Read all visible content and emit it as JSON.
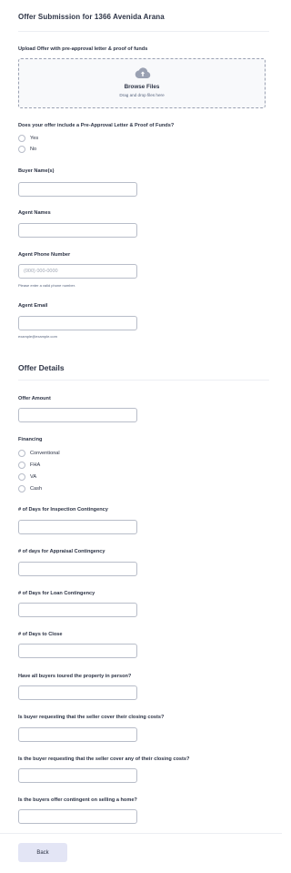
{
  "form": {
    "title": "Offer Submission for 1366 Avenida Arana"
  },
  "upload": {
    "label": "Upload Offer with pre-approval letter & proof of funds",
    "browse_label": "Browse Files",
    "drag_text": "Drag and drop files here",
    "icon": "cloud-upload-icon"
  },
  "preapproval": {
    "label": "Does your offer include a Pre-Approval Letter & Proof of Funds?",
    "options": [
      "Yes",
      "No"
    ]
  },
  "buyer_names": {
    "label": "Buyer Name(s)",
    "value": ""
  },
  "agent_names": {
    "label": "Agent Names",
    "value": ""
  },
  "agent_phone": {
    "label": "Agent Phone Number",
    "placeholder": "(000) 000-0000",
    "sublabel": "Please enter a valid phone number."
  },
  "agent_email": {
    "label": "Agent Email",
    "sublabel": "example@example.com"
  },
  "offer_details": {
    "title": "Offer Details"
  },
  "offer_amount": {
    "label": "Offer Amount"
  },
  "financing": {
    "label": "Financing",
    "options": [
      "Conventional",
      "FHA",
      "VA",
      "Cash"
    ]
  },
  "inspection_days": {
    "label": "# of Days for Inspection Contingency"
  },
  "appraisal_days": {
    "label": "# of days for Appraisal Contingency"
  },
  "loan_days": {
    "label": "# of Days for Loan Contingency"
  },
  "close_days": {
    "label": "# of Days to Close"
  },
  "toured": {
    "label": "Have all buyers toured the property in person?"
  },
  "seller_cover_closing": {
    "label": "Is buyer requesting that the seller cover their closing costs?"
  },
  "seller_cover_any": {
    "label": "Is the buyer requesting that the seller cover any of their closing costs?"
  },
  "contingent_sale": {
    "label": "Is the buyers offer contingent on selling a home?"
  },
  "footer": {
    "back_label": "Back"
  }
}
